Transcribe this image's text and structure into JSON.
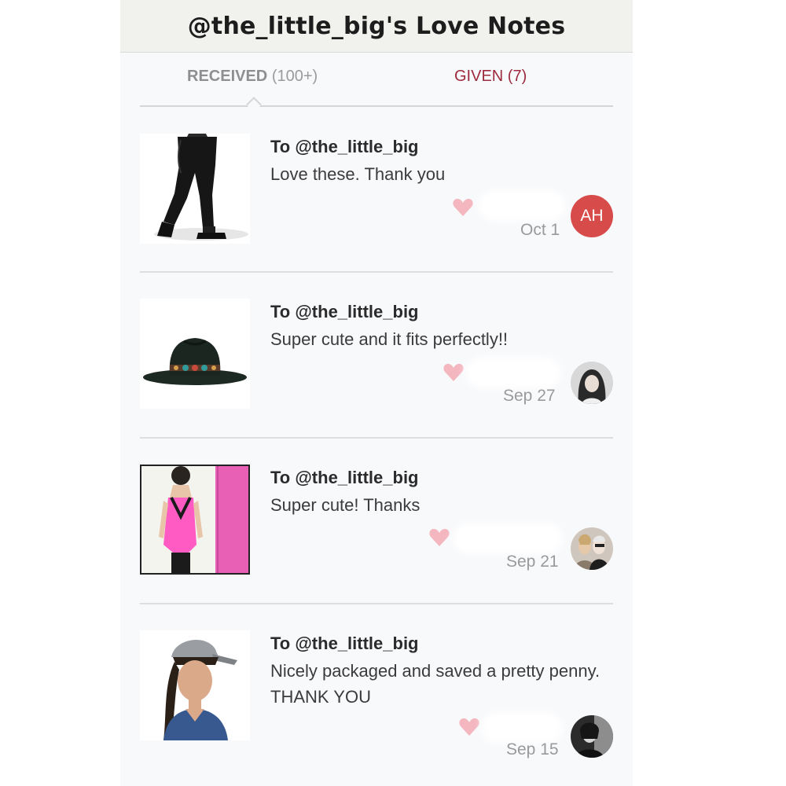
{
  "header": {
    "title": "@the_little_big's Love Notes"
  },
  "tabs": {
    "received_label": "RECEIVED",
    "received_count": "(100+)",
    "given_label": "GIVEN (7)"
  },
  "notes": [
    {
      "to": "To @the_little_big",
      "message": "Love these. Thank you",
      "date": "Oct 1",
      "avatar_initials": "AH",
      "item": "black-jogger-pants",
      "avatar": "initials"
    },
    {
      "to": "To @the_little_big",
      "message": "Super cute and it fits perfectly!!",
      "date": "Sep 27",
      "item": "black-fedora-hat",
      "avatar": "photo"
    },
    {
      "to": "To @the_little_big",
      "message": "Super cute! Thanks",
      "date": "Sep 21",
      "item": "pink-racerback-tank",
      "avatar": "photo"
    },
    {
      "to": "To @the_little_big",
      "message": "Nicely packaged and saved a pretty penny. THANK YOU",
      "date": "Sep 15",
      "item": "grey-baseball-cap",
      "avatar": "photo"
    }
  ],
  "colors": {
    "accent": "#9d2b3d",
    "heart": "#f4b6bf",
    "avatar_initials_bg": "#d74b4b"
  }
}
